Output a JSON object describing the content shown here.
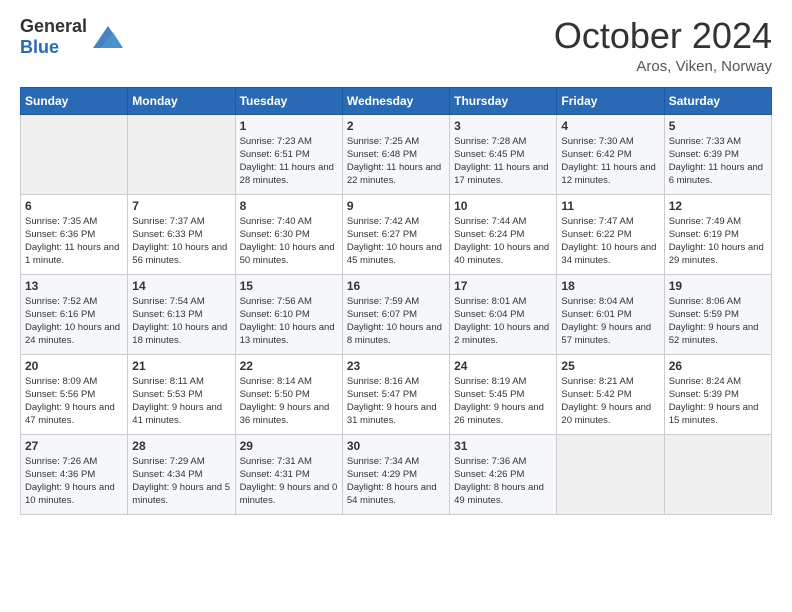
{
  "header": {
    "logo_general": "General",
    "logo_blue": "Blue",
    "month_year": "October 2024",
    "location": "Aros, Viken, Norway"
  },
  "days_of_week": [
    "Sunday",
    "Monday",
    "Tuesday",
    "Wednesday",
    "Thursday",
    "Friday",
    "Saturday"
  ],
  "weeks": [
    [
      {
        "day": "",
        "empty": true
      },
      {
        "day": "",
        "empty": true
      },
      {
        "day": "1",
        "sunrise": "Sunrise: 7:23 AM",
        "sunset": "Sunset: 6:51 PM",
        "daylight": "Daylight: 11 hours and 28 minutes."
      },
      {
        "day": "2",
        "sunrise": "Sunrise: 7:25 AM",
        "sunset": "Sunset: 6:48 PM",
        "daylight": "Daylight: 11 hours and 22 minutes."
      },
      {
        "day": "3",
        "sunrise": "Sunrise: 7:28 AM",
        "sunset": "Sunset: 6:45 PM",
        "daylight": "Daylight: 11 hours and 17 minutes."
      },
      {
        "day": "4",
        "sunrise": "Sunrise: 7:30 AM",
        "sunset": "Sunset: 6:42 PM",
        "daylight": "Daylight: 11 hours and 12 minutes."
      },
      {
        "day": "5",
        "sunrise": "Sunrise: 7:33 AM",
        "sunset": "Sunset: 6:39 PM",
        "daylight": "Daylight: 11 hours and 6 minutes."
      }
    ],
    [
      {
        "day": "6",
        "sunrise": "Sunrise: 7:35 AM",
        "sunset": "Sunset: 6:36 PM",
        "daylight": "Daylight: 11 hours and 1 minute."
      },
      {
        "day": "7",
        "sunrise": "Sunrise: 7:37 AM",
        "sunset": "Sunset: 6:33 PM",
        "daylight": "Daylight: 10 hours and 56 minutes."
      },
      {
        "day": "8",
        "sunrise": "Sunrise: 7:40 AM",
        "sunset": "Sunset: 6:30 PM",
        "daylight": "Daylight: 10 hours and 50 minutes."
      },
      {
        "day": "9",
        "sunrise": "Sunrise: 7:42 AM",
        "sunset": "Sunset: 6:27 PM",
        "daylight": "Daylight: 10 hours and 45 minutes."
      },
      {
        "day": "10",
        "sunrise": "Sunrise: 7:44 AM",
        "sunset": "Sunset: 6:24 PM",
        "daylight": "Daylight: 10 hours and 40 minutes."
      },
      {
        "day": "11",
        "sunrise": "Sunrise: 7:47 AM",
        "sunset": "Sunset: 6:22 PM",
        "daylight": "Daylight: 10 hours and 34 minutes."
      },
      {
        "day": "12",
        "sunrise": "Sunrise: 7:49 AM",
        "sunset": "Sunset: 6:19 PM",
        "daylight": "Daylight: 10 hours and 29 minutes."
      }
    ],
    [
      {
        "day": "13",
        "sunrise": "Sunrise: 7:52 AM",
        "sunset": "Sunset: 6:16 PM",
        "daylight": "Daylight: 10 hours and 24 minutes."
      },
      {
        "day": "14",
        "sunrise": "Sunrise: 7:54 AM",
        "sunset": "Sunset: 6:13 PM",
        "daylight": "Daylight: 10 hours and 18 minutes."
      },
      {
        "day": "15",
        "sunrise": "Sunrise: 7:56 AM",
        "sunset": "Sunset: 6:10 PM",
        "daylight": "Daylight: 10 hours and 13 minutes."
      },
      {
        "day": "16",
        "sunrise": "Sunrise: 7:59 AM",
        "sunset": "Sunset: 6:07 PM",
        "daylight": "Daylight: 10 hours and 8 minutes."
      },
      {
        "day": "17",
        "sunrise": "Sunrise: 8:01 AM",
        "sunset": "Sunset: 6:04 PM",
        "daylight": "Daylight: 10 hours and 2 minutes."
      },
      {
        "day": "18",
        "sunrise": "Sunrise: 8:04 AM",
        "sunset": "Sunset: 6:01 PM",
        "daylight": "Daylight: 9 hours and 57 minutes."
      },
      {
        "day": "19",
        "sunrise": "Sunrise: 8:06 AM",
        "sunset": "Sunset: 5:59 PM",
        "daylight": "Daylight: 9 hours and 52 minutes."
      }
    ],
    [
      {
        "day": "20",
        "sunrise": "Sunrise: 8:09 AM",
        "sunset": "Sunset: 5:56 PM",
        "daylight": "Daylight: 9 hours and 47 minutes."
      },
      {
        "day": "21",
        "sunrise": "Sunrise: 8:11 AM",
        "sunset": "Sunset: 5:53 PM",
        "daylight": "Daylight: 9 hours and 41 minutes."
      },
      {
        "day": "22",
        "sunrise": "Sunrise: 8:14 AM",
        "sunset": "Sunset: 5:50 PM",
        "daylight": "Daylight: 9 hours and 36 minutes."
      },
      {
        "day": "23",
        "sunrise": "Sunrise: 8:16 AM",
        "sunset": "Sunset: 5:47 PM",
        "daylight": "Daylight: 9 hours and 31 minutes."
      },
      {
        "day": "24",
        "sunrise": "Sunrise: 8:19 AM",
        "sunset": "Sunset: 5:45 PM",
        "daylight": "Daylight: 9 hours and 26 minutes."
      },
      {
        "day": "25",
        "sunrise": "Sunrise: 8:21 AM",
        "sunset": "Sunset: 5:42 PM",
        "daylight": "Daylight: 9 hours and 20 minutes."
      },
      {
        "day": "26",
        "sunrise": "Sunrise: 8:24 AM",
        "sunset": "Sunset: 5:39 PM",
        "daylight": "Daylight: 9 hours and 15 minutes."
      }
    ],
    [
      {
        "day": "27",
        "sunrise": "Sunrise: 7:26 AM",
        "sunset": "Sunset: 4:36 PM",
        "daylight": "Daylight: 9 hours and 10 minutes."
      },
      {
        "day": "28",
        "sunrise": "Sunrise: 7:29 AM",
        "sunset": "Sunset: 4:34 PM",
        "daylight": "Daylight: 9 hours and 5 minutes."
      },
      {
        "day": "29",
        "sunrise": "Sunrise: 7:31 AM",
        "sunset": "Sunset: 4:31 PM",
        "daylight": "Daylight: 9 hours and 0 minutes."
      },
      {
        "day": "30",
        "sunrise": "Sunrise: 7:34 AM",
        "sunset": "Sunset: 4:29 PM",
        "daylight": "Daylight: 8 hours and 54 minutes."
      },
      {
        "day": "31",
        "sunrise": "Sunrise: 7:36 AM",
        "sunset": "Sunset: 4:26 PM",
        "daylight": "Daylight: 8 hours and 49 minutes."
      },
      {
        "day": "",
        "empty": true
      },
      {
        "day": "",
        "empty": true
      }
    ]
  ]
}
